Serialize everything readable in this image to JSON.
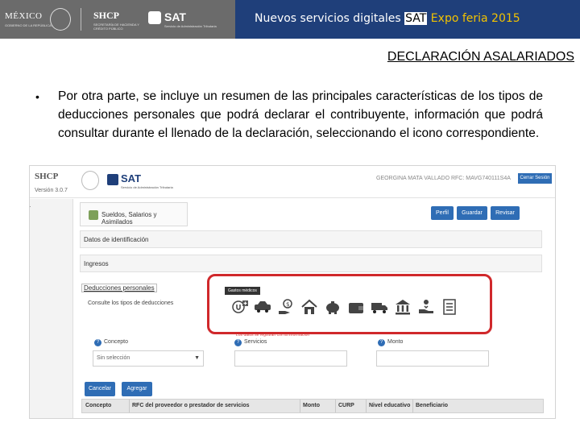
{
  "banner": {
    "mexico_label": "MÉXICO",
    "mexico_sub": "GOBIERNO DE LA REPÚBLICA",
    "shcp_label": "SHCP",
    "shcp_sub": "SECRETARÍA DE HACIENDA Y CRÉDITO PÚBLICO",
    "sat_label": "SAT",
    "sat_sub": "Servicio de Administración Tributaria",
    "title_prefix": "Nuevos servicios digitales ",
    "title_sat": "SAT",
    "title_suffix": " Expo feria 2015",
    "colors": {
      "left_bg": "#6b6b6b",
      "right_bg": "#1f3f7a",
      "expo_text": "#f2c200"
    }
  },
  "slide": {
    "heading": "DECLARACIÓN ASALARIADOS",
    "bullet_symbol": "•",
    "bullet_text": "Por otra parte, se incluye un resumen de las principales características de los tipos de deducciones personales que podrá declarar el contribuyente, información que podrá consultar durante el llenado de la declaración, seleccionando el icono correspondiente."
  },
  "screenshot": {
    "header": {
      "shcp_label": "SHCP",
      "version": "Versión 3.0.7",
      "sat_label": "SAT",
      "sat_sub": "Servicio de Administración Tributaria",
      "user_info": "GEORGINA MATA VALLADO RFC: MAVG740111S4A",
      "close_session": "Cerrar Sesión"
    },
    "left_arrow": "r",
    "section_tab": "Sueldos, Salarios y Asimilados",
    "buttons": {
      "perfil": "Perfil",
      "guardar": "Guardar",
      "revisar": "Revisar"
    },
    "panels": {
      "datos": "Datos de identificación",
      "ingresos": "Ingresos"
    },
    "deducciones": {
      "title": "Deducciones personales",
      "consulte": "Consulte los tipos de deducciones",
      "tooltip": "Gastos médicos",
      "icons": [
        "medical-icon",
        "ambulance-car-icon",
        "money-hand-icon",
        "house-icon",
        "piggy-bank-icon",
        "wallet-icon",
        "truck-icon",
        "bank-icon",
        "donation-icon",
        "checklist-icon"
      ],
      "faint_note": "Los datos se registran con la información"
    },
    "form": {
      "concepto_label": "Concepto",
      "concepto_value": "Sin selección",
      "servicios_label": "Servicios",
      "monto_label": "Monto"
    },
    "actions": {
      "cancelar": "Cancelar",
      "agregar": "Agregar"
    },
    "table_headers": [
      "Concepto",
      "RFC del proveedor o prestador de servicios",
      "Monto",
      "CURP",
      "Nivel educativo",
      "Beneficiario"
    ],
    "highlight_color": "#d0282b",
    "accent_blue": "#2f6db5"
  }
}
